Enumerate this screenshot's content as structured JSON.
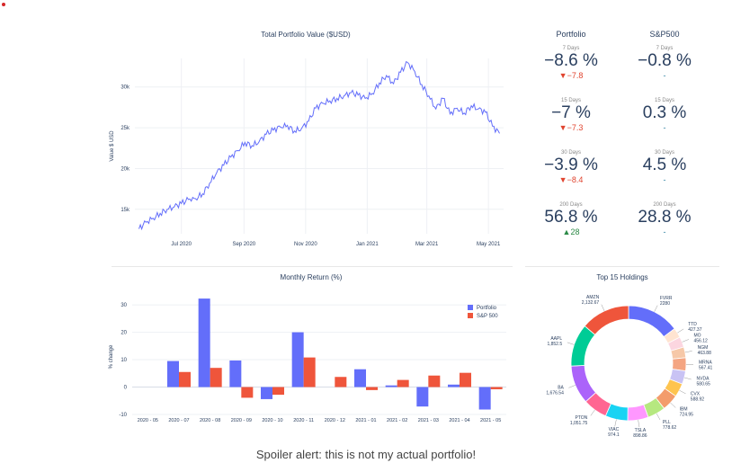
{
  "caption": "Spoiler alert: this is not my actual portfolio!",
  "chart_data": [
    {
      "type": "line",
      "title": "Total Portfolio Value ($USD)",
      "ylabel": "Value $ USD",
      "xlabel": "",
      "x_ticks": [
        "Jul 2020",
        "Sep 2020",
        "Nov 2020",
        "Jan 2021",
        "Mar 2021",
        "May 2021"
      ],
      "y_ticks": [
        "15k",
        "20k",
        "25k",
        "30k"
      ],
      "ylim": [
        12000,
        33500
      ],
      "color": "#636efa",
      "grid": true,
      "series": [
        {
          "x": [
            "2020-05-20",
            "2020-05-27",
            "2020-06-03",
            "2020-06-10",
            "2020-06-17",
            "2020-06-24",
            "2020-07-01",
            "2020-07-08",
            "2020-07-15",
            "2020-07-22",
            "2020-07-29",
            "2020-08-05",
            "2020-08-12",
            "2020-08-19",
            "2020-08-26",
            "2020-09-02",
            "2020-09-09",
            "2020-09-16",
            "2020-09-23",
            "2020-09-30",
            "2020-10-07",
            "2020-10-14",
            "2020-10-21",
            "2020-10-28",
            "2020-11-04",
            "2020-11-11",
            "2020-11-18",
            "2020-11-25",
            "2020-12-02",
            "2020-12-09",
            "2020-12-16",
            "2020-12-23",
            "2020-12-30",
            "2021-01-06",
            "2021-01-13",
            "2021-01-20",
            "2021-01-27",
            "2021-02-03",
            "2021-02-10",
            "2021-02-17",
            "2021-02-24",
            "2021-03-03",
            "2021-03-10",
            "2021-03-17",
            "2021-03-24",
            "2021-03-31",
            "2021-04-07",
            "2021-04-14",
            "2021-04-21",
            "2021-04-28",
            "2021-05-05",
            "2021-05-12"
          ],
          "values": [
            12600,
            13400,
            13900,
            14500,
            15000,
            15300,
            15700,
            16200,
            16300,
            16900,
            18200,
            19500,
            20400,
            21400,
            22200,
            23200,
            22800,
            23300,
            24200,
            24700,
            25100,
            25300,
            24600,
            24900,
            25800,
            27400,
            28000,
            28300,
            28600,
            28900,
            29300,
            29000,
            28600,
            29200,
            30500,
            31400,
            30400,
            31800,
            33000,
            31900,
            30300,
            28900,
            27300,
            28600,
            26700,
            27400,
            26800,
            27700,
            27300,
            26900,
            25200,
            24300
          ]
        }
      ]
    },
    {
      "type": "bar",
      "title": "Monthly Return (%)",
      "ylabel": "% change",
      "xlabel": "",
      "categories": [
        "2020 - 05",
        "2020 - 07",
        "2020 - 08",
        "2020 - 09",
        "2020 - 10",
        "2020 - 11",
        "2020 - 12",
        "2021 - 01",
        "2021 - 02",
        "2021 - 03",
        "2021 - 04",
        "2021 - 05"
      ],
      "y_ticks": [
        -10,
        0,
        10,
        20,
        30
      ],
      "ylim": [
        -10,
        32
      ],
      "grid": true,
      "legend_position": "top-right",
      "series": [
        {
          "name": "Portfolio",
          "color": "#636efa",
          "values": [
            0,
            9.5,
            32.3,
            9.7,
            -4.4,
            20.0,
            0,
            6.5,
            0.6,
            -7.1,
            0.9,
            -8.2
          ]
        },
        {
          "name": "S&P 500",
          "color": "#ef553b",
          "values": [
            0,
            5.5,
            7.0,
            -3.9,
            -2.8,
            10.8,
            3.7,
            -1.1,
            2.6,
            4.2,
            5.2,
            -0.8
          ]
        }
      ]
    },
    {
      "type": "pie",
      "title": "Top 15 Holdings",
      "hole": true,
      "labels": [
        "FVRR",
        "TTD",
        "MO",
        "NGM",
        "MRNA",
        "NVDA",
        "CVX",
        "IBM",
        "PLL",
        "TSLA",
        "VIAC",
        "PTON",
        "BA",
        "AAPL",
        "AMZN"
      ],
      "values": [
        2280,
        427.37,
        456.12,
        463.88,
        567.41,
        580.65,
        588.92,
        724.95,
        778.62,
        898.86,
        974.1,
        1051.75,
        1676.54,
        1852.5,
        2132.67
      ],
      "value_labels": [
        "2280",
        "427.37",
        "456.12",
        "463.88",
        "567.41",
        "580.65",
        "588.92",
        "724.95",
        "778.62",
        "898.86",
        "974.1",
        "1,051.75",
        "1,676.54",
        "1,852.5",
        "2,132.67"
      ],
      "colors": [
        "#636efa",
        "#ffe4d1",
        "#fcd6e0",
        "#f6c8a8",
        "#f4a582",
        "#c9c3f4",
        "#fec44f",
        "#f39c6b",
        "#b6e880",
        "#ff97ff",
        "#19d3f3",
        "#ff6692",
        "#ab63fa",
        "#00cc96",
        "#ef553b"
      ]
    }
  ],
  "stats": {
    "portfolio_header": "Portfolio",
    "sp500_header": "S&P500",
    "rows": [
      {
        "period": "7 Days",
        "portfolio": "−8.6 %",
        "portfolio_delta": "▼−7.8",
        "delta_dir": "down",
        "sp500": "−0.8 %",
        "sp500_delta": "-"
      },
      {
        "period": "15 Days",
        "portfolio": "−7 %",
        "portfolio_delta": "▼−7.3",
        "delta_dir": "down",
        "sp500": "0.3 %",
        "sp500_delta": "-"
      },
      {
        "period": "30 Days",
        "portfolio": "−3.9 %",
        "portfolio_delta": "▼−8.4",
        "delta_dir": "down",
        "sp500": "4.5 %",
        "sp500_delta": "-"
      },
      {
        "period": "200 Days",
        "portfolio": "56.8 %",
        "portfolio_delta": "▲28",
        "delta_dir": "up",
        "sp500": "28.8 %",
        "sp500_delta": "-"
      }
    ]
  }
}
